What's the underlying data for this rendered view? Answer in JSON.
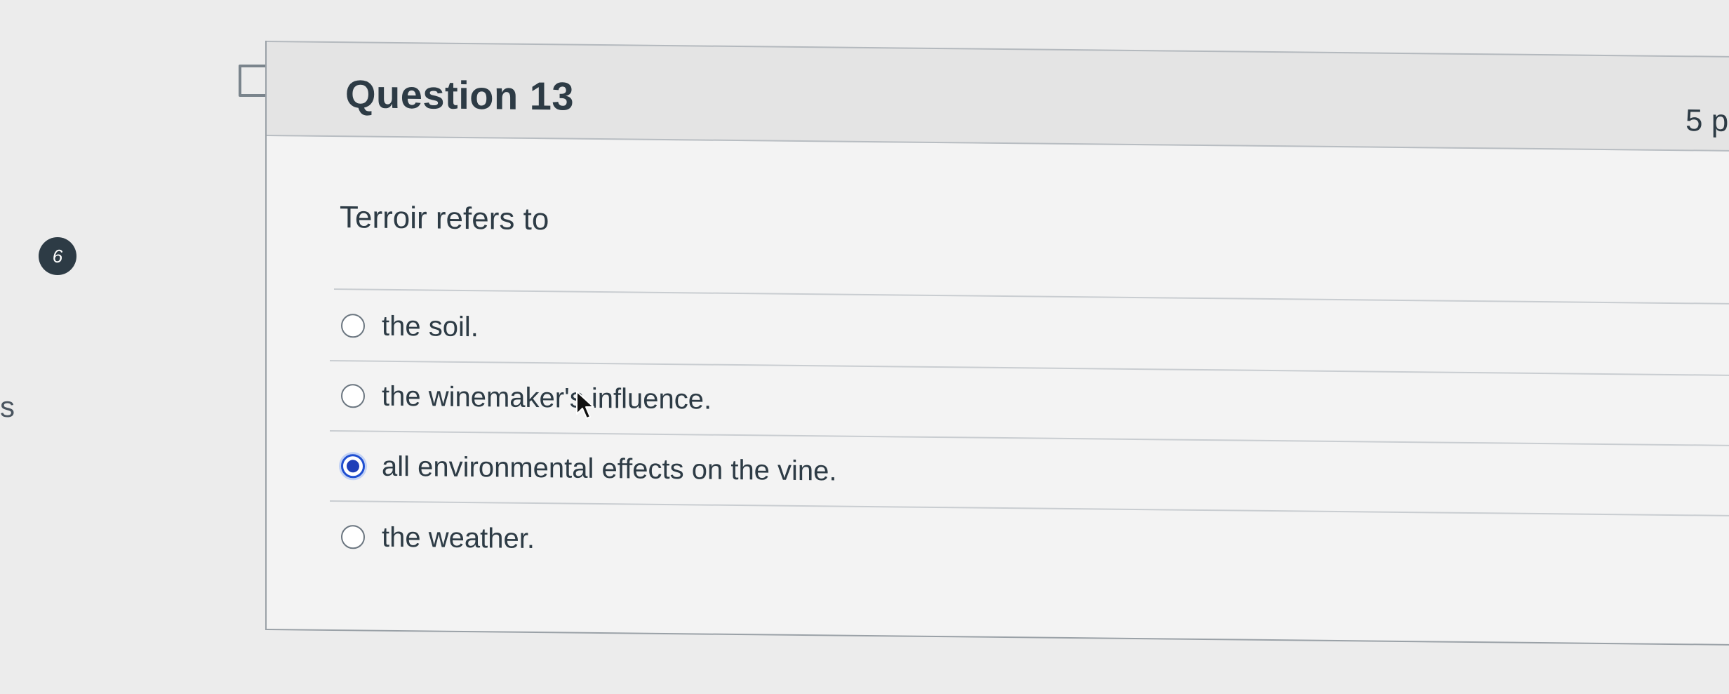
{
  "sidebar": {
    "badge_count": "6",
    "partial_letter": "s"
  },
  "question": {
    "title": "Question 13",
    "points": "5 p",
    "text": "Terroir refers to",
    "answers": [
      {
        "label": "the soil.",
        "selected": false
      },
      {
        "label": "the winemaker's influence.",
        "selected": false
      },
      {
        "label": "all environmental effects on the vine.",
        "selected": true
      },
      {
        "label": "the weather.",
        "selected": false
      }
    ]
  },
  "icons": {
    "flag": "flag-icon",
    "cursor": "mouse-pointer-icon"
  },
  "colors": {
    "selected_radio": "#1f3fb8",
    "text": "#2d3b45",
    "header_bg": "#e4e4e4"
  }
}
